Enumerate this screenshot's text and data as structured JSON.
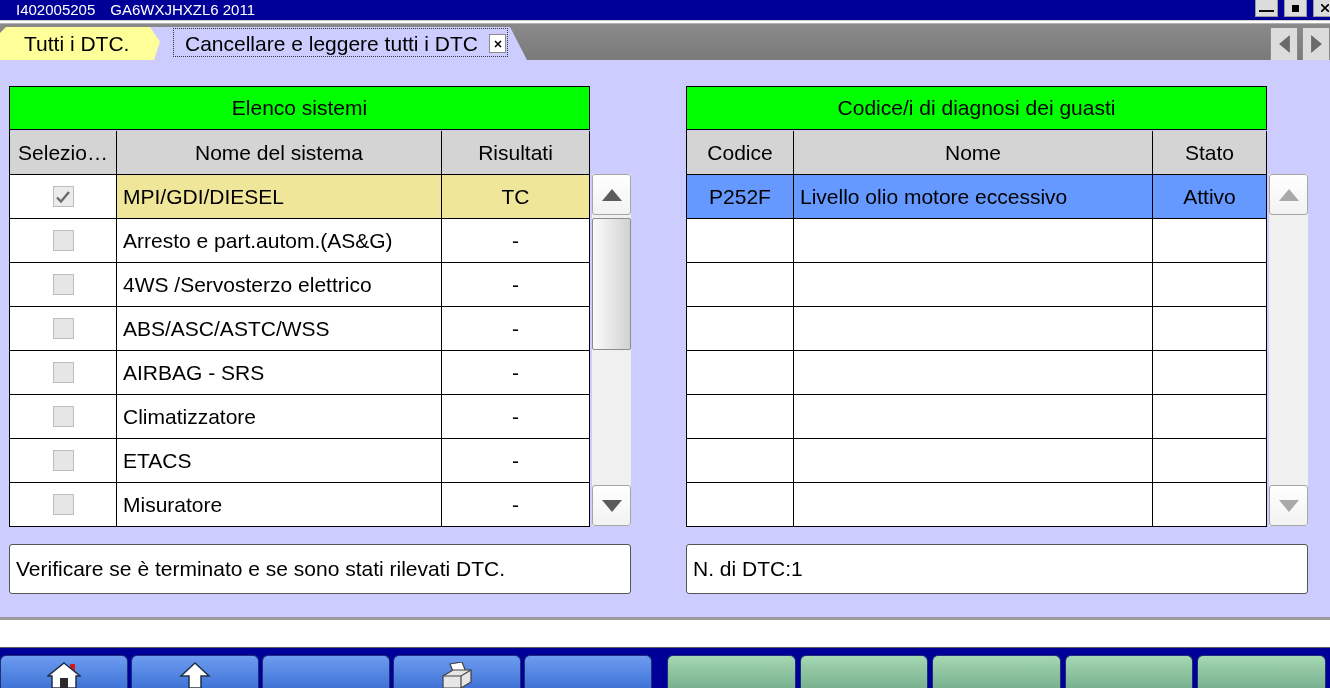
{
  "window": {
    "title_id": "I402005205",
    "title_vehicle": "GA6WXJHXZL6 2011"
  },
  "tabs": [
    {
      "label": "Tutti i DTC.",
      "selected": false,
      "closable": false
    },
    {
      "label": "Cancellare e leggere tutti i DTC",
      "selected": true,
      "closable": true
    }
  ],
  "systems": {
    "title": "Elenco sistemi",
    "columns": [
      "Selezio…",
      "Nome del sistema",
      "Risultati"
    ],
    "rows": [
      {
        "checked": true,
        "selected": true,
        "name": "MPI/GDI/DIESEL",
        "result": "TC"
      },
      {
        "checked": false,
        "selected": false,
        "name": "Arresto e part.autom.(AS&G)",
        "result": "-"
      },
      {
        "checked": false,
        "selected": false,
        "name": "4WS /Servosterzo elettrico",
        "result": "-"
      },
      {
        "checked": false,
        "selected": false,
        "name": "ABS/ASC/ASTC/WSS",
        "result": "-"
      },
      {
        "checked": false,
        "selected": false,
        "name": "AIRBAG - SRS",
        "result": "-"
      },
      {
        "checked": false,
        "selected": false,
        "name": "Climatizzatore",
        "result": "-"
      },
      {
        "checked": false,
        "selected": false,
        "name": "ETACS",
        "result": "-"
      },
      {
        "checked": false,
        "selected": false,
        "name": "Misuratore",
        "result": "-"
      }
    ],
    "message": "Verificare se è terminato e se sono stati rilevati DTC."
  },
  "dtc": {
    "title": "Codice/i di diagnosi dei guasti",
    "columns": [
      "Codice",
      "Nome",
      "Stato"
    ],
    "rows": [
      {
        "code": "P252F",
        "name": "Livello olio motore eccessivo",
        "status": "Attivo",
        "selected": true
      }
    ],
    "message": "N. di DTC:1"
  }
}
